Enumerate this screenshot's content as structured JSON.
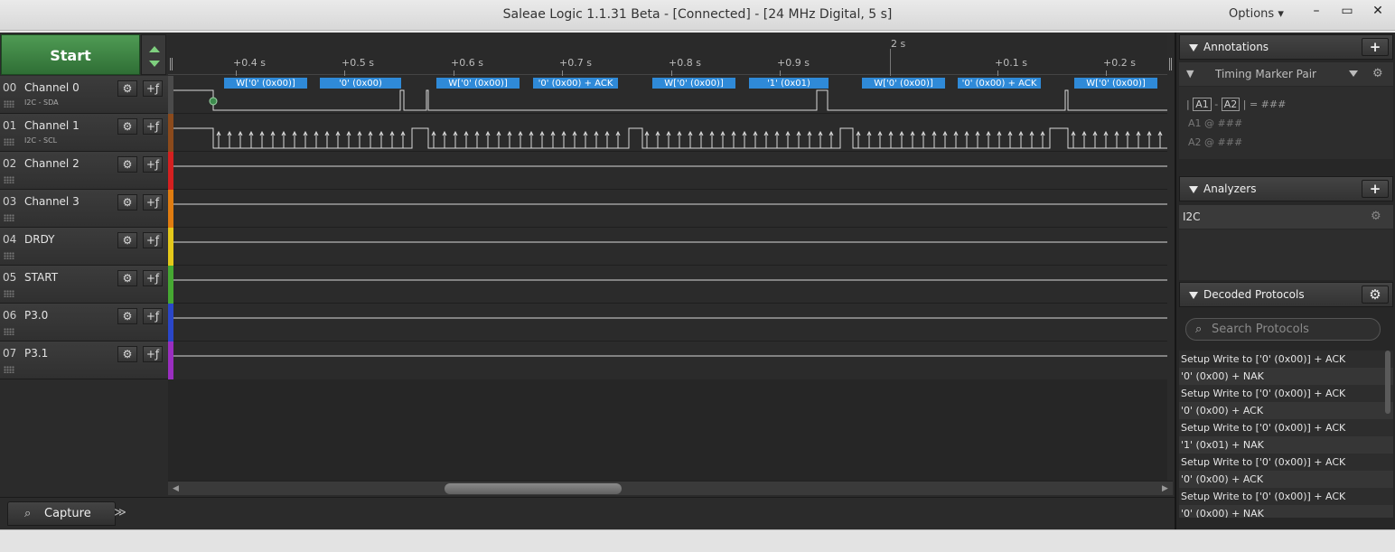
{
  "window": {
    "title": "Saleae Logic 1.1.31 Beta - [Connected] - [24 MHz Digital, 5 s]",
    "options_label": "Options",
    "minimize": "–",
    "maximize": "▭",
    "close": "✕"
  },
  "start_button": {
    "label": "Start"
  },
  "timeline": {
    "center_label": "2 s",
    "ticks": [
      "+0.4 s",
      "+0.5 s",
      "+0.6 s",
      "+0.7 s",
      "+0.8 s",
      "+0.9 s",
      "+0.1 s",
      "+0.2 s"
    ]
  },
  "channels": [
    {
      "index": "00",
      "name": "Channel 0",
      "sub": "I2C - SDA",
      "color": "#4b4b4b"
    },
    {
      "index": "01",
      "name": "Channel 1",
      "sub": "I2C - SCL",
      "color": "#8b4a1c"
    },
    {
      "index": "02",
      "name": "Channel 2",
      "sub": "",
      "color": "#d42020"
    },
    {
      "index": "03",
      "name": "Channel 3",
      "sub": "",
      "color": "#e07c10"
    },
    {
      "index": "04",
      "name": "DRDY",
      "sub": "",
      "color": "#e4c81a"
    },
    {
      "index": "05",
      "name": "START",
      "sub": "",
      "color": "#46a832"
    },
    {
      "index": "06",
      "name": "P3.0",
      "sub": "",
      "color": "#2a46c8"
    },
    {
      "index": "07",
      "name": "P3.1",
      "sub": "",
      "color": "#9a2ec0"
    }
  ],
  "decode_labels": [
    "W['0' (0x00)]",
    "'0' (0x00)",
    "W['0' (0x00)]",
    "'0' (0x00) + ACK",
    "W['0' (0x00)]",
    "'1' (0x01)",
    "W['0' (0x00)]",
    "'0' (0x00) + ACK",
    "W['0' (0x00)]"
  ],
  "tabs": {
    "capture": "Capture",
    "more": "≫"
  },
  "annotations": {
    "title": "Annotations",
    "add": "+",
    "marker_pair": "Timing Marker Pair",
    "m1": "A1",
    "m2": "A2",
    "diff_dash": "-",
    "equals": "| = ###",
    "a1_line": "A1  @  ###",
    "a2_line": "A2  @  ###"
  },
  "analyzers": {
    "title": "Analyzers",
    "add": "+",
    "items": [
      "I2C"
    ]
  },
  "decoded": {
    "title": "Decoded Protocols",
    "search_placeholder": "Search Protocols",
    "rows": [
      "Setup Write to ['0' (0x00)] + ACK",
      "'0' (0x00) + NAK",
      "Setup Write to ['0' (0x00)] + ACK",
      "'0' (0x00) + ACK",
      "Setup Write to ['0' (0x00)] + ACK",
      "'1' (0x01) + NAK",
      "Setup Write to ['0' (0x00)] + ACK",
      "'0' (0x00) + ACK",
      "Setup Write to ['0' (0x00)] + ACK",
      "'0' (0x00) + NAK"
    ]
  }
}
